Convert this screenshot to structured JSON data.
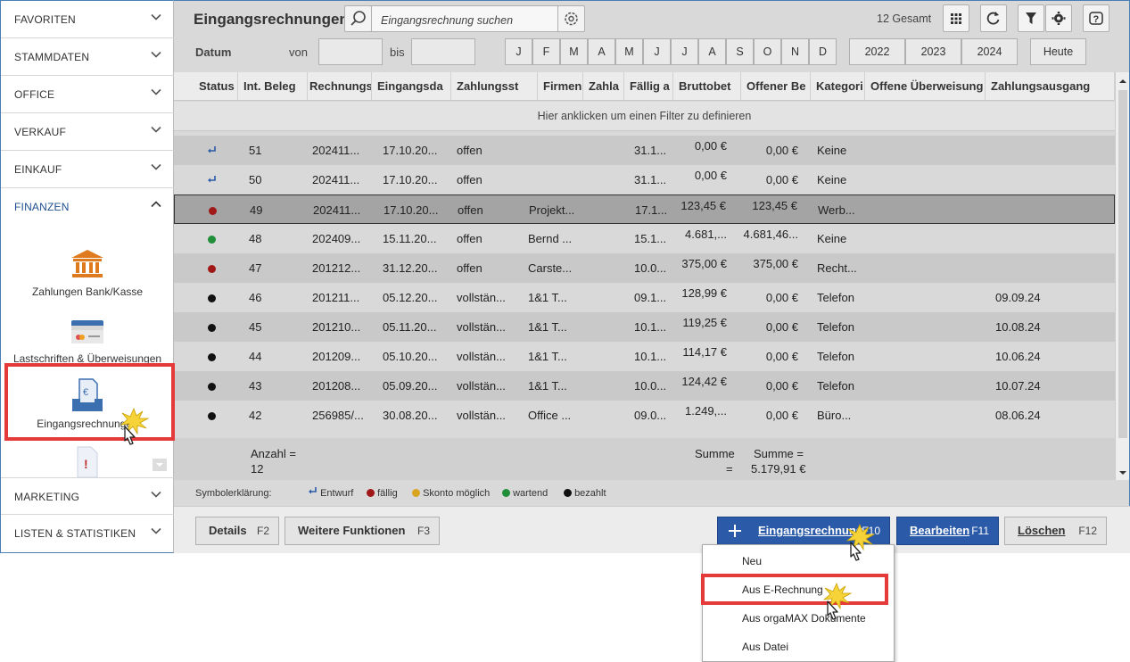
{
  "sidebar": {
    "sections_top": [
      "FAVORITEN",
      "STAMMDATEN",
      "OFFICE",
      "VERKAUF",
      "EINKAUF"
    ],
    "active_section": "FINANZEN",
    "items": [
      {
        "label": "Zahlungen Bank/Kasse",
        "icon": "bank-icon"
      },
      {
        "label": "Lastschriften & Überweisungen",
        "icon": "credit-card-icon"
      },
      {
        "label": "Eingangsrechnungen",
        "icon": "invoice-tray-icon"
      }
    ],
    "sections_bottom": [
      "MARKETING",
      "LISTEN & STATISTIKEN"
    ]
  },
  "header": {
    "title": "Eingangsrechnungen",
    "search_placeholder": "Eingangsrechnung suchen",
    "total": "12 Gesamt"
  },
  "datefilter": {
    "label": "Datum",
    "from": "von",
    "to": "bis",
    "months": [
      "J",
      "F",
      "M",
      "A",
      "M",
      "J",
      "J",
      "A",
      "S",
      "O",
      "N",
      "D"
    ],
    "years": [
      "2022",
      "2023",
      "2024"
    ],
    "today": "Heute"
  },
  "table": {
    "columns": [
      "Status",
      "Int. Beleg",
      "Rechnungs",
      "Eingangsda",
      "Zahlungsst",
      "Firmenna",
      "Zahla",
      "Fällig a",
      "Bruttobet",
      "Offener Be",
      "Kategori",
      "Offene Überweisung",
      "Zahlungsausgang"
    ],
    "filter_hint": "Hier anklicken um einen Filter zu definieren",
    "rows": [
      {
        "status": "draft",
        "beleg": "51",
        "rechnung": "202411...",
        "eingang": "17.10.20...",
        "zstatus": "offen",
        "firma": "",
        "faellig": "31.1...",
        "brutto": "0,00 €",
        "offen": "0,00 €",
        "kategorie": "Keine",
        "ausgang": ""
      },
      {
        "status": "draft",
        "beleg": "50",
        "rechnung": "202411...",
        "eingang": "17.10.20...",
        "zstatus": "offen",
        "firma": "",
        "faellig": "31.1...",
        "brutto": "0,00 €",
        "offen": "0,00 €",
        "kategorie": "Keine",
        "ausgang": ""
      },
      {
        "status": "due",
        "beleg": "49",
        "rechnung": "202411...",
        "eingang": "17.10.20...",
        "zstatus": "offen",
        "firma": "Projekt...",
        "faellig": "17.1...",
        "brutto": "123,45 €",
        "offen": "123,45 €",
        "kategorie": "Werb...",
        "ausgang": ""
      },
      {
        "status": "waiting",
        "beleg": "48",
        "rechnung": "202409...",
        "eingang": "15.11.20...",
        "zstatus": "offen",
        "firma": "Bernd ...",
        "faellig": "15.1...",
        "brutto": "4.681,...",
        "offen": "4.681,46...",
        "kategorie": "Keine",
        "ausgang": ""
      },
      {
        "status": "due",
        "beleg": "47",
        "rechnung": "201212...",
        "eingang": "31.12.20...",
        "zstatus": "offen",
        "firma": "Carste...",
        "faellig": "10.0...",
        "brutto": "375,00 €",
        "offen": "375,00 €",
        "kategorie": "Recht...",
        "ausgang": ""
      },
      {
        "status": "paid",
        "beleg": "46",
        "rechnung": "201211...",
        "eingang": "05.12.20...",
        "zstatus": "vollstän...",
        "firma": "1&1 T...",
        "faellig": "09.1...",
        "brutto": "128,99 €",
        "offen": "0,00 €",
        "kategorie": "Telefon",
        "ausgang": "09.09.24"
      },
      {
        "status": "paid",
        "beleg": "45",
        "rechnung": "201210...",
        "eingang": "05.11.20...",
        "zstatus": "vollstän...",
        "firma": "1&1 T...",
        "faellig": "10.1...",
        "brutto": "119,25 €",
        "offen": "0,00 €",
        "kategorie": "Telefon",
        "ausgang": "10.08.24"
      },
      {
        "status": "paid",
        "beleg": "44",
        "rechnung": "201209...",
        "eingang": "05.10.20...",
        "zstatus": "vollstän...",
        "firma": "1&1 T...",
        "faellig": "10.1...",
        "brutto": "114,17 €",
        "offen": "0,00 €",
        "kategorie": "Telefon",
        "ausgang": "10.06.24"
      },
      {
        "status": "paid",
        "beleg": "43",
        "rechnung": "201208...",
        "eingang": "05.09.20...",
        "zstatus": "vollstän...",
        "firma": "1&1 T...",
        "faellig": "10.0...",
        "brutto": "124,42 €",
        "offen": "0,00 €",
        "kategorie": "Telefon",
        "ausgang": "10.07.24"
      },
      {
        "status": "paid",
        "beleg": "42",
        "rechnung": "256985/...",
        "eingang": "30.08.20...",
        "zstatus": "vollstän...",
        "firma": "Office ...",
        "faellig": "09.0...",
        "brutto": "1.249,...",
        "offen": "0,00 €",
        "kategorie": "Büro...",
        "ausgang": "08.06.24"
      }
    ],
    "footer": {
      "anzahl_label": "Anzahl =",
      "anzahl_value": "12",
      "summe1_label": "Summe",
      "summe1_value": "=",
      "summe2_label": "Summe =",
      "summe2_value": "5.179,91 €"
    }
  },
  "legend": {
    "title": "Symbolerklärung:",
    "items": [
      {
        "label": "Entwurf",
        "color": "#2a5aa8"
      },
      {
        "label": "fällig",
        "color": "#a01818"
      },
      {
        "label": "Skonto möglich",
        "color": "#d9a520"
      },
      {
        "label": "wartend",
        "color": "#1f8f3a"
      },
      {
        "label": "bezahlt",
        "color": "#111111"
      }
    ]
  },
  "actions": {
    "details": "Details",
    "details_key": "F2",
    "more": "Weitere Funktionen",
    "more_key": "F3",
    "new": "Eingangsrechnung",
    "new_key": "F10",
    "edit": "Bearbeiten",
    "edit_key": "F11",
    "delete": "Löschen",
    "delete_key": "F12"
  },
  "dropdown": {
    "items": [
      "Neu",
      "Aus E-Rechnung",
      "Aus orgaMAX Dokumente",
      "Aus Datei"
    ]
  },
  "colors": {
    "accent": "#2a5aa8",
    "highlight": "#e53a3a",
    "due": "#a01818",
    "waiting": "#1f8f3a",
    "paid": "#111111"
  }
}
